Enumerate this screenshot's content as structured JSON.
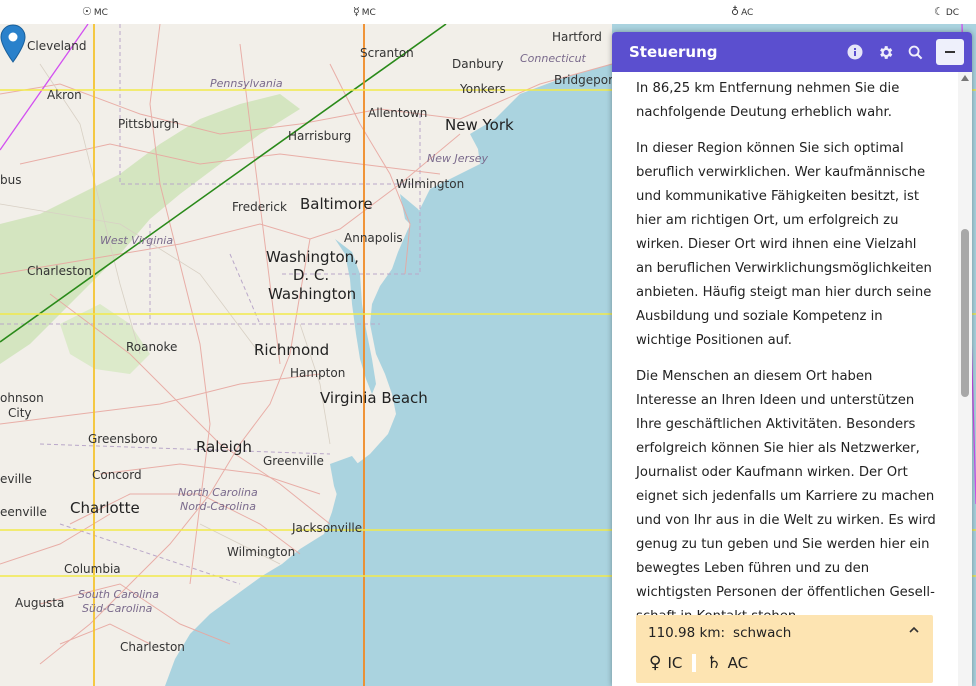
{
  "top_labels": [
    {
      "symbol": "☉",
      "text": "MC"
    },
    {
      "symbol": "☿",
      "text": "MC"
    },
    {
      "symbol": "♁",
      "text": "AC"
    },
    {
      "symbol": "☾",
      "text": "DC"
    }
  ],
  "map": {
    "places": [
      "Cleveland",
      "Akron",
      "Pittsburgh",
      "Pennsylvania",
      "Scranton",
      "Hartford",
      "Connecticut",
      "Danbury",
      "Bridgeport",
      "Yonkers",
      "New York",
      "Allentown",
      "Harrisburg",
      "New Jersey",
      "Wilmington",
      "Frederick",
      "Baltimore",
      "Annapolis",
      "West Virginia",
      "Washington, D. C.",
      "Washington",
      "Charleston",
      "Roanoke",
      "Richmond",
      "Hampton",
      "Virginia Beach",
      "Greensboro",
      "Raleigh",
      "Greenville",
      "Concord",
      "Charlotte",
      "North Carolina",
      "Nord-Carolina",
      "Jacksonville",
      "Wilmington",
      "Columbia",
      "South Carolina",
      "Süd-Carolina",
      "Augusta",
      "Charleston",
      "bus",
      "ohnson",
      "City",
      "eville",
      "eenville"
    ],
    "marker": "map-pin-icon"
  },
  "panel": {
    "title": "Steuerung",
    "icons": [
      "info-icon",
      "gear-icon",
      "search-icon"
    ],
    "paragraphs": [
      "In 86,25 km Entfernung nehmen Sie die nachfol­gende Deutung erheblich wahr.",
      "In dieser Region können Sie sich optimal beruflich verwirklichen. Wer kaufmännische und kommunikative Fähigkeiten besitzt, ist hier am richtigen Ort, um erfolgreich zu wirken. Dieser Ort wird ihnen eine Vielzahl an beruflichen Verwirklichungsmöglichkeiten anbieten. Häufig steigt man hier durch seine Ausbildung und soziale Kompetenz in wichtige Positionen auf.",
      "Die Menschen an diesem Ort haben Interesse an Ihren Ideen und unterstützen Ihre geschäftlichen Aktivitäten. Besonders erfolgreich können Sie hier als Netzwerker, Journalist oder Kaufmann wirken. Der Ort eignet sich jedenfalls um Karriere zu machen und von Ihr aus in die Welt zu wirken. Es wird genug zu tun geben und Sie werden hier ein bewegtes Leben führen und zu den wichtigsten Personen der öffentlichen Gesell­schaft in Kontakt stehen."
    ],
    "result": {
      "distance": "110.98 km:",
      "strength": "schwach",
      "aspects": [
        {
          "symbol": "♀",
          "text": "IC"
        },
        {
          "symbol": "♄",
          "text": "AC"
        }
      ]
    }
  },
  "colors": {
    "panel_header": "#5b4fcf",
    "water": "#aad3df",
    "land": "#f2efe9",
    "result_bg": "#fde4b2",
    "line_green": "#2a8a1a",
    "line_magenta": "#d24ff0",
    "line_yellow": "#f2ea4a",
    "line_orange": "#f09a2a"
  }
}
